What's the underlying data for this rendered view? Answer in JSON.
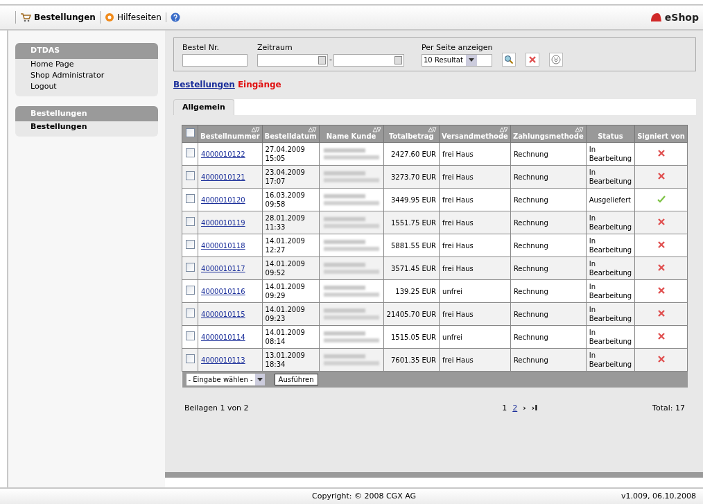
{
  "toolbar": {
    "items": [
      {
        "label": "Bestellungen"
      },
      {
        "label": "Hilfeseiten"
      }
    ],
    "brand": "eShop"
  },
  "sidebar": [
    {
      "title": "DTDAS",
      "items": [
        {
          "label": "Home Page",
          "selected": false
        },
        {
          "label": "Shop Administrator",
          "selected": false
        },
        {
          "label": "Logout",
          "selected": false
        }
      ]
    },
    {
      "title": "Bestellungen",
      "items": [
        {
          "label": "Bestellungen",
          "selected": true
        }
      ]
    }
  ],
  "filter": {
    "order_label": "Bestel Nr.",
    "period_label": "Zeitraum",
    "separator": "-",
    "per_page_label": "Per Seite anzeigen",
    "per_page_value": "10 Resultat"
  },
  "links": [
    {
      "label": "Bestellungen",
      "kind": "link"
    },
    {
      "label": "Eingänge",
      "kind": "alert"
    }
  ],
  "tabs": [
    {
      "label": "Allgemein",
      "selected": true
    }
  ],
  "table": {
    "header_checked": false,
    "columns": [
      {
        "label": "Bestellnummer",
        "sortable": true
      },
      {
        "label": "Bestelldatum",
        "sortable": true
      },
      {
        "label": "Name Kunde",
        "sortable": true
      },
      {
        "label": "Totalbetrag",
        "sortable": true
      },
      {
        "label": "Versandmethode",
        "sortable": true
      },
      {
        "label": "Zahlungsmethode",
        "sortable": true
      },
      {
        "label": "Status",
        "sortable": false
      },
      {
        "label": "Signiert von",
        "sortable": false
      }
    ],
    "rows": [
      {
        "checked": false,
        "number": "4000010122",
        "date": "27.04.2009",
        "time": "15:05",
        "amount": "2427.60 EUR",
        "shipping": "frei Haus",
        "payment": "Rechnung",
        "status": "In Bearbeitung",
        "signed": false
      },
      {
        "checked": false,
        "number": "4000010121",
        "date": "23.04.2009",
        "time": "17:07",
        "amount": "3273.70 EUR",
        "shipping": "frei Haus",
        "payment": "Rechnung",
        "status": "In Bearbeitung",
        "signed": false
      },
      {
        "checked": false,
        "number": "4000010120",
        "date": "16.03.2009",
        "time": "09:58",
        "amount": "3449.95 EUR",
        "shipping": "frei Haus",
        "payment": "Rechnung",
        "status": "Ausgeliefert",
        "signed": true
      },
      {
        "checked": false,
        "number": "4000010119",
        "date": "28.01.2009",
        "time": "11:33",
        "amount": "1551.75 EUR",
        "shipping": "frei Haus",
        "payment": "Rechnung",
        "status": "In Bearbeitung",
        "signed": false
      },
      {
        "checked": false,
        "number": "4000010118",
        "date": "14.01.2009",
        "time": "12:27",
        "amount": "5881.55 EUR",
        "shipping": "frei Haus",
        "payment": "Rechnung",
        "status": "In Bearbeitung",
        "signed": false
      },
      {
        "checked": false,
        "number": "4000010117",
        "date": "14.01.2009",
        "time": "09:52",
        "amount": "3571.45 EUR",
        "shipping": "frei Haus",
        "payment": "Rechnung",
        "status": "In Bearbeitung",
        "signed": false
      },
      {
        "checked": false,
        "number": "4000010116",
        "date": "14.01.2009",
        "time": "09:29",
        "amount": "139.25 EUR",
        "shipping": "unfrei",
        "payment": "Rechnung",
        "status": "In Bearbeitung",
        "signed": false
      },
      {
        "checked": false,
        "number": "4000010115",
        "date": "14.01.2009",
        "time": "09:23",
        "amount": "21405.70 EUR",
        "shipping": "frei Haus",
        "payment": "Rechnung",
        "status": "In Bearbeitung",
        "signed": false
      },
      {
        "checked": false,
        "number": "4000010114",
        "date": "14.01.2009",
        "time": "08:14",
        "amount": "1515.05 EUR",
        "shipping": "unfrei",
        "payment": "Rechnung",
        "status": "In Bearbeitung",
        "signed": false
      },
      {
        "checked": false,
        "number": "4000010113",
        "date": "13.01.2009",
        "time": "18:34",
        "amount": "7601.35 EUR",
        "shipping": "frei Haus",
        "payment": "Rechnung",
        "status": "In Bearbeitung",
        "signed": false
      }
    ],
    "action_select": "- Eingabe wählen -",
    "action_button": "Ausführen"
  },
  "pager": {
    "pages_text": "Beilagen 1 von 2",
    "pages": [
      {
        "label": "1",
        "selected": true
      },
      {
        "label": "2",
        "selected": false
      }
    ],
    "next": "›",
    "last": "›I",
    "total": "Total: 17"
  },
  "footer": {
    "copyright": "Copyright: © 2008 CGX AG",
    "version": "v1.009, 06.10.2008"
  }
}
